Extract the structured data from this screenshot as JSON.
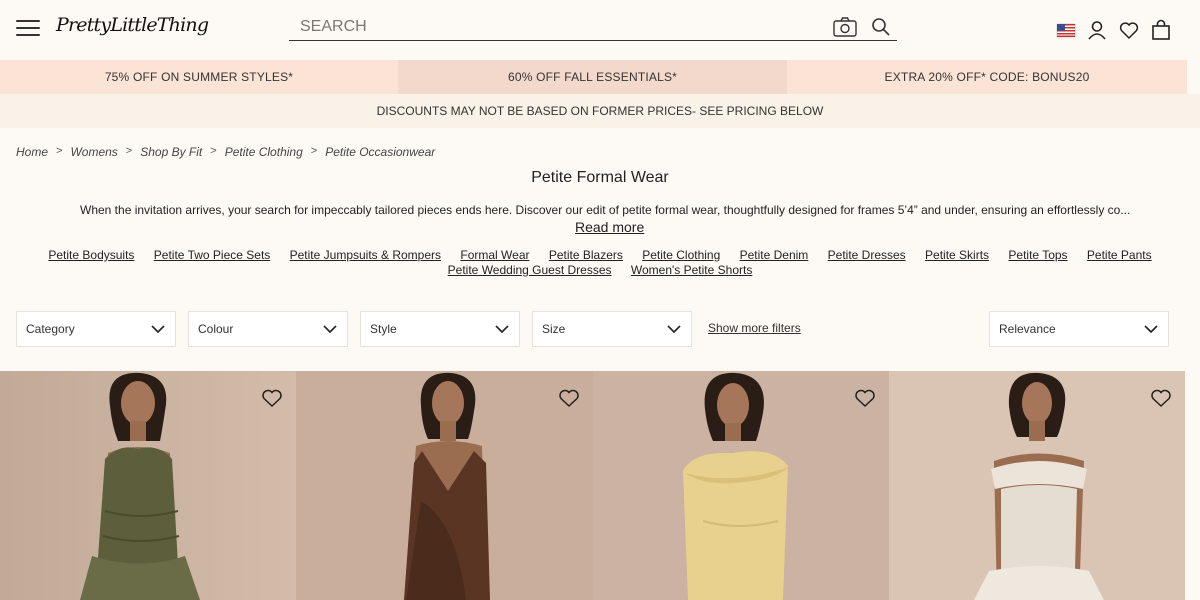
{
  "header": {
    "logo": "PrettyLittleThing",
    "search_placeholder": "SEARCH"
  },
  "promos": [
    "75% OFF ON SUMMER STYLES*",
    "60% OFF FALL ESSENTIALS*",
    "EXTRA 20% OFF* CODE: BONUS20"
  ],
  "disclaimer": "DISCOUNTS MAY NOT BE BASED ON FORMER PRICES- SEE PRICING BELOW",
  "breadcrumb": [
    "Home",
    "Womens",
    "Shop By Fit",
    "Petite Clothing",
    "Petite Occasionwear"
  ],
  "page_title": "Petite Formal Wear",
  "intro": "When the invitation arrives, your search for impeccably tailored pieces ends here. Discover our edit of petite formal wear, thoughtfully designed for frames 5’4” and under, ensuring an effortlessly co...",
  "read_more": "Read more",
  "category_links": [
    "Petite Bodysuits",
    "Petite Two Piece Sets",
    "Petite Jumpsuits & Rompers",
    "Formal Wear",
    "Petite Blazers",
    "Petite Clothing",
    "Petite Denim",
    "Petite Dresses",
    "Petite Skirts",
    "Petite Tops",
    "Petite Pants",
    "Petite Wedding Guest Dresses",
    "Women's Petite Shorts"
  ],
  "filters": [
    "Category",
    "Colour",
    "Style",
    "Size"
  ],
  "show_more_filters": "Show more filters",
  "sort": "Relevance",
  "products": [
    {
      "dress_color": "#5c5e3c",
      "bg": "#cfb8a6"
    },
    {
      "dress_color": "#5a3524",
      "bg": "#c9ae9c"
    },
    {
      "dress_color": "#e8d08e",
      "bg": "#cfb6a6"
    },
    {
      "dress_color": "#e6ddd2",
      "bg": "#d9c4b4"
    }
  ],
  "icons": [
    "hamburger-icon",
    "camera-icon",
    "search-icon",
    "us-flag-icon",
    "account-icon",
    "wishlist-icon",
    "bag-icon",
    "chevron-down-icon",
    "heart-icon"
  ]
}
